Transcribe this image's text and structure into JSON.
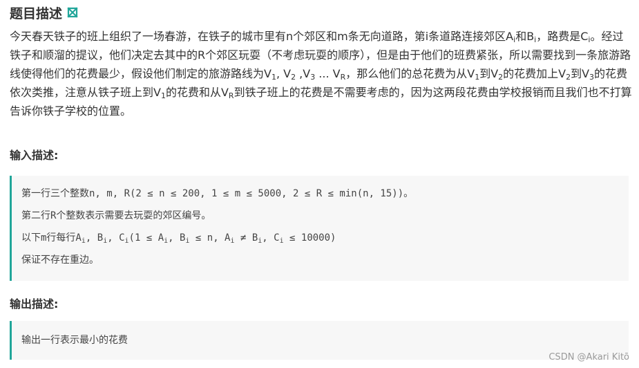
{
  "header": {
    "title": "题目描述",
    "icon": "expand-icon"
  },
  "description": {
    "s1": "今天春天铁子的班上组织了一场春游，在铁子的城市里有n个郊区和m条无向道路，第i条道路连接郊区A",
    "s1_sub": "i",
    "s2": "和B",
    "s2_sub": "i",
    "s3": "，路费是C",
    "s3_sub": "i",
    "s4": "。经过铁子和顺溜的提议，他们决定去其中的R个郊区玩耍（不考虑玩耍的顺序），但是由于他们的班费紧张，所以需要找到一条旅游路线使得他们的花费最少，假设他们制定的旅游路线为V",
    "s4_sub": "1",
    "s5": ", V",
    "s5_sub": "2",
    "s6": " ,V",
    "s6_sub": "3",
    "s7": " ... V",
    "s7_sub": "R",
    "s8": "，那么他们的总花费为从V",
    "s8_sub": "1",
    "s9": "到V",
    "s9_sub": "2",
    "s10": "的花费加上V",
    "s10_sub": "2",
    "s11": "到V",
    "s11_sub": "3",
    "s12": "的花费依次类推，注意从铁子班上到V",
    "s12_sub": "1",
    "s13": "的花费和从V",
    "s13_sub": "R",
    "s14": "到铁子班上的花费是不需要考虑的，因为这两段花费由学校报销而且我们也不打算告诉你铁子学校的位置。"
  },
  "input_section": {
    "heading": "输入描述:",
    "line1": "第一行三个整数n, m, R(2 ≤ n ≤ 200, 1 ≤ m ≤ 5000, 2 ≤ R ≤ min(n, 15))。",
    "line2": "第二行R个整数表示需要去玩耍的郊区编号。",
    "line3_a": "以下m行每行A",
    "line3_a_sub": "i",
    "line3_b": ", B",
    "line3_b_sub": "i",
    "line3_c": ", C",
    "line3_c_sub": "i",
    "line3_d": "(1 ≤ A",
    "line3_d_sub": "i",
    "line3_e": ", B",
    "line3_e_sub": "i",
    "line3_f": " ≤ n, A",
    "line3_f_sub": "i",
    "line3_g": " ≠ B",
    "line3_g_sub": "i",
    "line3_h": ", C",
    "line3_h_sub": "i",
    "line3_i": " ≤ 10000)",
    "line4": "保证不存在重边。"
  },
  "output_section": {
    "heading": "输出描述:",
    "line1": "输出一行表示最小的花费"
  },
  "watermark": "CSDN @Akari  Kitō",
  "colors": {
    "accent": "#21a69a",
    "code_bg": "#f7f7f7",
    "text": "#333333"
  }
}
